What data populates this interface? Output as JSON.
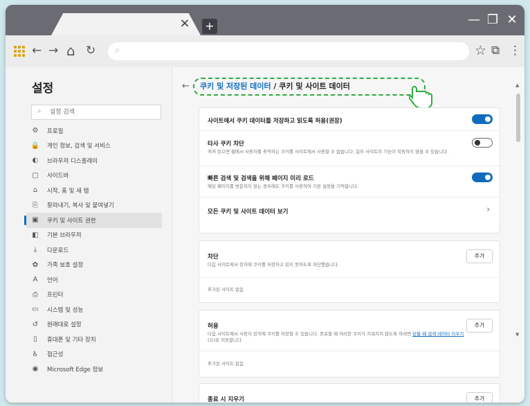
{
  "browser": {
    "new_tab": "+",
    "tab_close": "×",
    "window_buttons": {
      "minimize": "—",
      "restore": "❐",
      "close": "✕"
    },
    "nav": {
      "back": "←",
      "forward": "→",
      "home": "⌂",
      "refresh": "↻"
    },
    "address_search_icon": "⌕",
    "right_icons": {
      "favorite": "☆",
      "collections": "⧉",
      "menu": "⋮"
    }
  },
  "sidebar": {
    "title": "설정",
    "search_placeholder": "설정 검색",
    "items": [
      {
        "icon": "⚙",
        "label": "프로필"
      },
      {
        "icon": "🔒",
        "label": "개인 정보, 검색 및 서비스"
      },
      {
        "icon": "◐",
        "label": "브라우저 디스플레이"
      },
      {
        "icon": "▢",
        "label": "사이드바"
      },
      {
        "icon": "⌂",
        "label": "시작, 홈 및 새 탭"
      },
      {
        "icon": "⎘",
        "label": "잘라내기, 복사 및 붙여넣기"
      },
      {
        "icon": "▣",
        "label": "쿠키 및 사이트 권한"
      },
      {
        "icon": "◧",
        "label": "기본 브라우저"
      },
      {
        "icon": "⤓",
        "label": "다운로드"
      },
      {
        "icon": "✿",
        "label": "가족 보호 설정"
      },
      {
        "icon": "A",
        "label": "언어"
      },
      {
        "icon": "⎙",
        "label": "프린터"
      },
      {
        "icon": "▭",
        "label": "시스템 및 성능"
      },
      {
        "icon": "↺",
        "label": "원래대로 설정"
      },
      {
        "icon": "▯",
        "label": "휴대폰 및 기타 장치"
      },
      {
        "icon": "♿",
        "label": "접근성"
      },
      {
        "icon": "◉",
        "label": "Microsoft Edge 정보"
      }
    ],
    "active_index": 6
  },
  "main": {
    "back_icon": "←",
    "breadcrumb_link": "쿠키 및 저장된 데이터",
    "breadcrumb_sep": " / ",
    "breadcrumb_current": "쿠키 및 사이트 데이터",
    "settings": [
      {
        "title": "사이트에서 쿠키 데이터를 저장하고 읽도록 허용(권장)",
        "desc": "",
        "toggle": "on"
      },
      {
        "title": "타사 쿠키 차단",
        "desc": "켜져 있으면 웹에서 사용자를 추적하는 쿠키를 사이트에서 사용할 수 없습니다. 일부 사이트의 기능이 작동하지 않을 수 있습니다.",
        "toggle": "off"
      },
      {
        "title": "빠른 검색 및 검색을 위해 페이지 미리 로드",
        "desc": "해당 페이지를 방문하지 않는 경우에도 쿠키를 사용하여 기본 설정을 기억합니다.",
        "toggle": "on"
      },
      {
        "title": "모든 쿠키 및 사이트 데이터 보기",
        "desc": "",
        "chevron": "›"
      }
    ],
    "block": {
      "title": "차단",
      "desc": "다음 사이트에서 장치에 쿠키를 저장하고 읽지 못하도록 차단했습니다.",
      "button": "추가",
      "empty": "추가된 사이트 없음"
    },
    "allow": {
      "title": "허용",
      "desc_before": "다음 사이트에서 사용자 장치에 쿠키를 저장할 수 있습니다. 종료할 때 이러한 쿠키가 지워지지 않도록 하려면",
      "desc_link": "닫을 때 검색 데이터 지우기",
      "desc_after": "(으)로 이동합니다.",
      "button": "추가",
      "empty": "추가된 사이트 없음"
    },
    "clear_on_exit": {
      "title": "종료 시 지우기",
      "button": "추가"
    }
  }
}
